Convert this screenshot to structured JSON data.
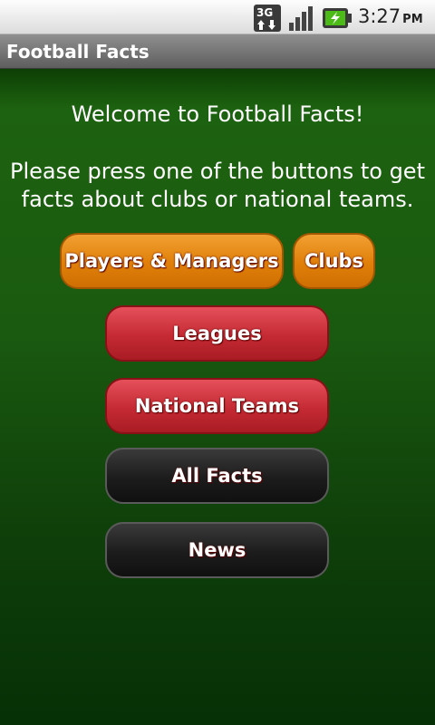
{
  "status_bar": {
    "network_icon": "3g-data-icon",
    "signal_icon": "signal-strength-icon",
    "battery_icon": "battery-charging-icon",
    "time": "3:27",
    "ampm": "PM"
  },
  "app": {
    "title": "Football Facts"
  },
  "main": {
    "welcome": "Welcome to Football Facts!",
    "instructions": "Please press one of the buttons to get facts about clubs or national teams."
  },
  "buttons": {
    "players_managers": "Players & Managers",
    "clubs": "Clubs",
    "leagues": "Leagues",
    "national_teams": "National Teams",
    "all_facts": "All Facts",
    "news": "News"
  },
  "colors": {
    "orange_button": "#e07f09",
    "red_button": "#c52a33",
    "dark_button": "#1c1c1c",
    "background_green": "#1a5a10"
  }
}
